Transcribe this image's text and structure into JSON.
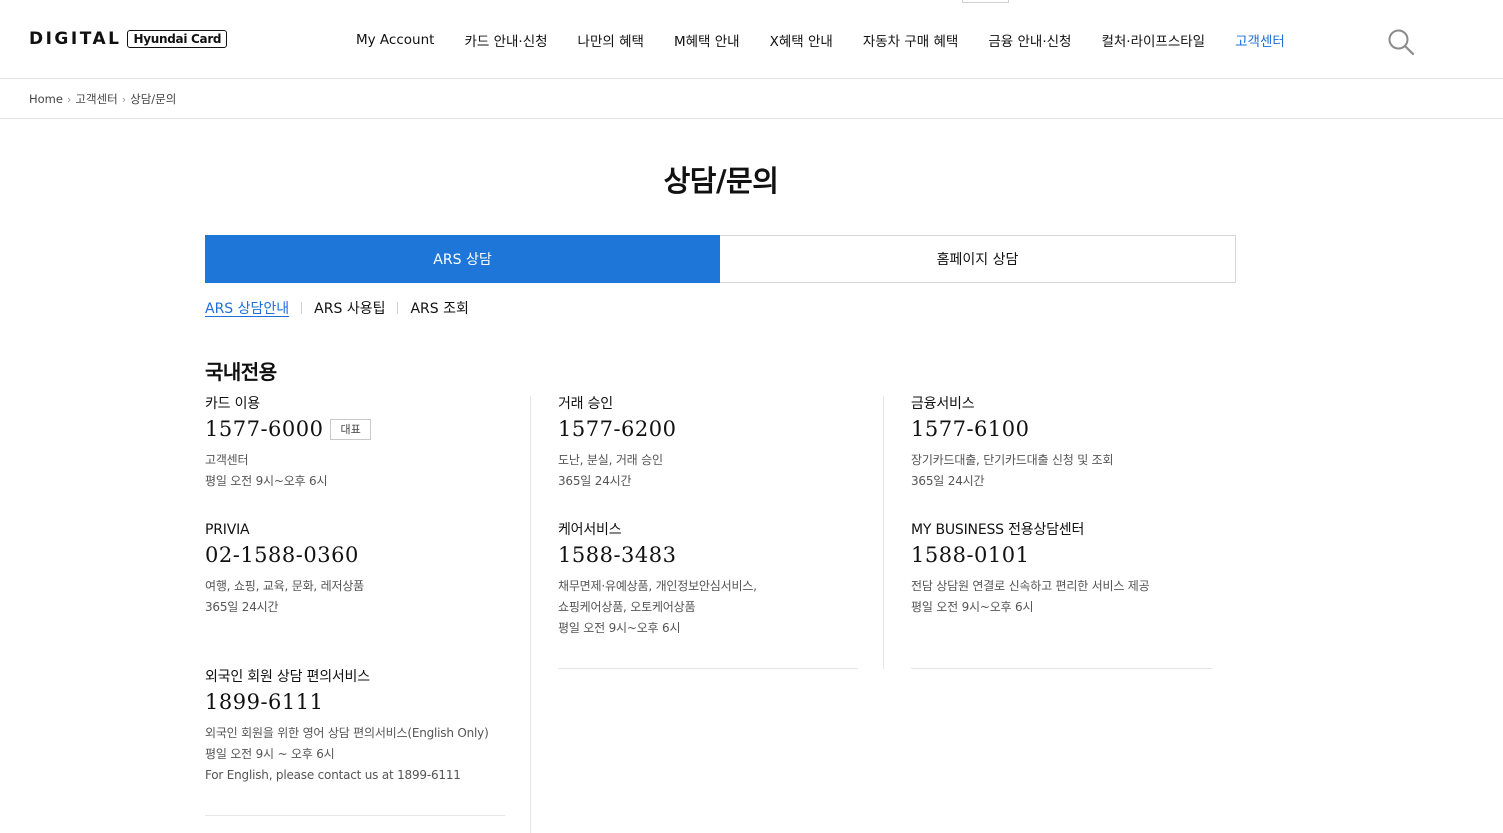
{
  "header": {
    "logo_digital": "DIGITAL",
    "logo_card": "Hyundai Card",
    "nav": [
      {
        "label": "My Account",
        "active": false
      },
      {
        "label": "카드 안내·신청",
        "active": false
      },
      {
        "label": "나만의 혜택",
        "active": false
      },
      {
        "label": "M혜택 안내",
        "active": false
      },
      {
        "label": "X혜택 안내",
        "active": false
      },
      {
        "label": "자동차 구매 혜택",
        "active": false
      },
      {
        "label": "금융 안내·신청",
        "active": false
      },
      {
        "label": "컬처·라이프스타일",
        "active": false
      },
      {
        "label": "고객센터",
        "active": true
      }
    ],
    "accent_color": "#1e6fd9"
  },
  "breadcrumb": [
    "Home",
    "고객센터",
    "상담/문의"
  ],
  "page_title": "상담/문의",
  "tabs": [
    {
      "label": "ARS 상담",
      "active": true
    },
    {
      "label": "홈페이지 상담",
      "active": false
    }
  ],
  "subtabs": [
    {
      "label": "ARS 상담안내",
      "active": true
    },
    {
      "label": "ARS 사용팁",
      "active": false
    },
    {
      "label": "ARS 조회",
      "active": false
    }
  ],
  "section_title": "국내전용",
  "columns": [
    [
      {
        "label": "카드 이용",
        "phone": "1577-6000",
        "badge": "대표",
        "desc": [
          "고객센터",
          "평일 오전 9시~오후 6시"
        ]
      },
      {
        "label": "PRIVIA",
        "phone": "02-1588-0360",
        "desc": [
          "여행, 쇼핑, 교육, 문화, 레저상품",
          "365일 24시간"
        ]
      },
      {
        "label": "외국인 회원 상담 편의서비스",
        "phone": "1899-6111",
        "desc": [
          "외국인 회원을 위한 영어 상담 편의서비스(English Only)",
          "평일 오전 9시 ~ 오후 6시",
          "For English, please contact us at 1899-6111"
        ]
      }
    ],
    [
      {
        "label": "거래 승인",
        "phone": "1577-6200",
        "desc": [
          "도난, 분실, 거래 승인",
          "365일 24시간"
        ]
      },
      {
        "label": "케어서비스",
        "phone": "1588-3483",
        "desc": [
          "채무면제·유예상품, 개인정보안심서비스,",
          "쇼핑케어상품, 오토케어상품",
          "평일 오전 9시~오후 6시"
        ]
      }
    ],
    [
      {
        "label": "금융서비스",
        "phone": "1577-6100",
        "desc": [
          "장기카드대출, 단기카드대출 신청 및 조회",
          "365일 24시간"
        ]
      },
      {
        "label": "MY BUSINESS 전용상담센터",
        "phone": "1588-0101",
        "desc": [
          "전담 상담원 연결로 신속하고 편리한 서비스 제공",
          "평일 오전 9시~오후 6시"
        ]
      }
    ]
  ]
}
